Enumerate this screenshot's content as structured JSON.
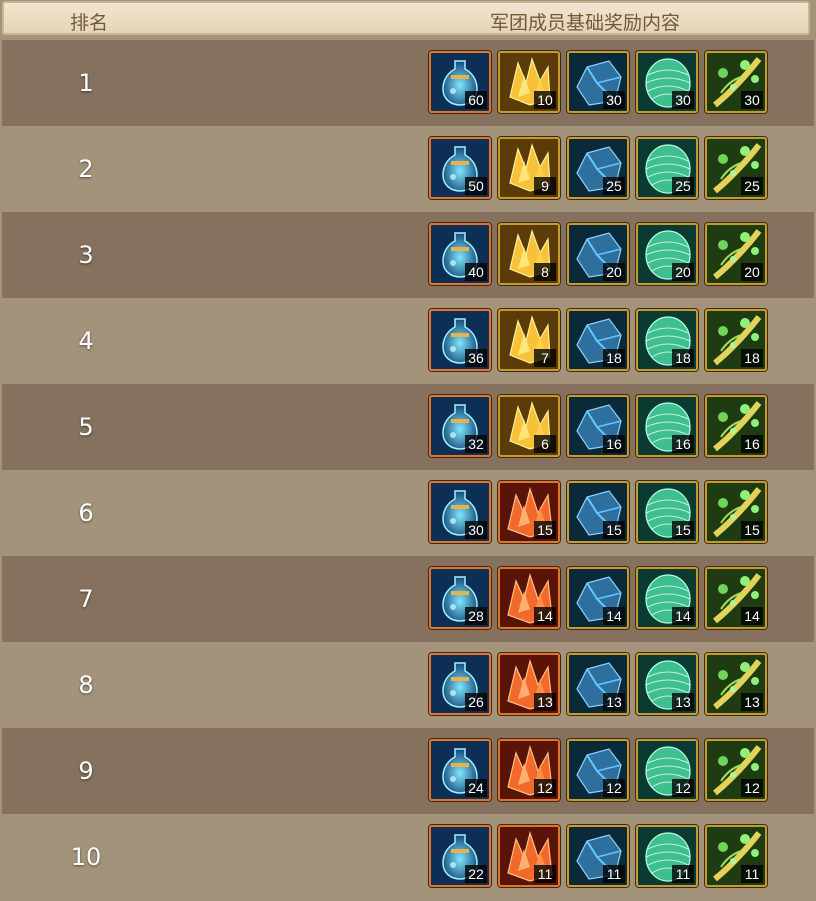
{
  "header": {
    "rank_label": "排名",
    "reward_label": "军团成员基础奖励内容"
  },
  "items": {
    "potion": "potion-icon",
    "gold_crystal": "gold-crystal-icon",
    "red_crystal": "red-crystal-icon",
    "blue_ore": "blue-ore-icon",
    "green_scale": "green-scale-icon",
    "vine": "vine-icon"
  },
  "colors": {
    "dark_row": "#85715d",
    "light_row": "#a3937a",
    "header_bg": "#efe3c9",
    "header_text": "#74583b",
    "slot_border_gold": "#c79a2e",
    "slot_border_orange": "#e0742c"
  },
  "rows": [
    {
      "rank": "1",
      "crystal": "gold",
      "rewards": [
        "60",
        "10",
        "30",
        "30",
        "30"
      ]
    },
    {
      "rank": "2",
      "crystal": "gold",
      "rewards": [
        "50",
        "9",
        "25",
        "25",
        "25"
      ]
    },
    {
      "rank": "3",
      "crystal": "gold",
      "rewards": [
        "40",
        "8",
        "20",
        "20",
        "20"
      ]
    },
    {
      "rank": "4",
      "crystal": "gold",
      "rewards": [
        "36",
        "7",
        "18",
        "18",
        "18"
      ]
    },
    {
      "rank": "5",
      "crystal": "gold",
      "rewards": [
        "32",
        "6",
        "16",
        "16",
        "16"
      ]
    },
    {
      "rank": "6",
      "crystal": "red",
      "rewards": [
        "30",
        "15",
        "15",
        "15",
        "15"
      ]
    },
    {
      "rank": "7",
      "crystal": "red",
      "rewards": [
        "28",
        "14",
        "14",
        "14",
        "14"
      ]
    },
    {
      "rank": "8",
      "crystal": "red",
      "rewards": [
        "26",
        "13",
        "13",
        "13",
        "13"
      ]
    },
    {
      "rank": "9",
      "crystal": "red",
      "rewards": [
        "24",
        "12",
        "12",
        "12",
        "12"
      ]
    },
    {
      "rank": "10",
      "crystal": "red",
      "rewards": [
        "22",
        "11",
        "11",
        "11",
        "11"
      ]
    }
  ]
}
